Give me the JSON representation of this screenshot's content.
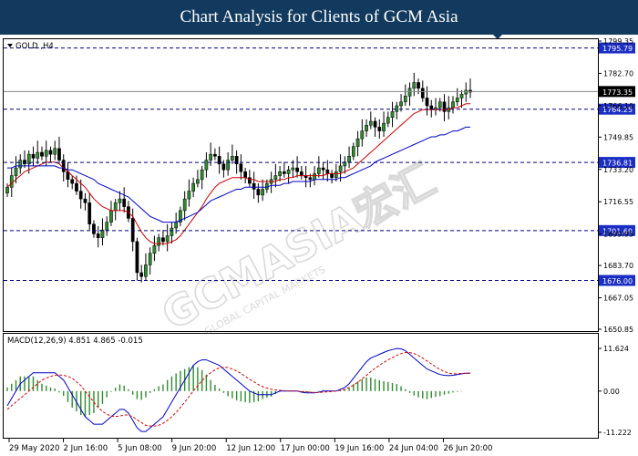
{
  "header": {
    "title": "Chart Analysis for Clients of GCM Asia"
  },
  "watermark": {
    "text": "GCMASIA宏汇",
    "subtext": "GLOBAL CAPITAL MARKETS"
  },
  "chart_data": [
    {
      "type": "candlestick",
      "symbol_label": "GOLD ,H4",
      "ylim": [
        1650.85,
        1799.35
      ],
      "y_ticks": [
        1799.35,
        1782.7,
        1766.1,
        1749.85,
        1733.2,
        1716.55,
        1699.95,
        1683.7,
        1667.05,
        1650.85
      ],
      "x_labels": [
        "29 May 2020",
        "2 Jun 16:00",
        "5 Jun 08:00",
        "9 Jun 20:00",
        "12 Jun 12:00",
        "17 Jun 00:00",
        "19 Jun 16:00",
        "24 Jun 04:00",
        "26 Jun 20:00"
      ],
      "levels": [
        1795.79,
        1764.25,
        1736.81,
        1701.69,
        1676.0
      ],
      "current_price": 1773.35,
      "series": [
        {
          "type": "candles",
          "close": [
            1724,
            1730,
            1734,
            1738,
            1736,
            1741,
            1739,
            1742,
            1740,
            1743,
            1741,
            1744,
            1738,
            1732,
            1728,
            1726,
            1722,
            1718,
            1716,
            1705,
            1700,
            1698,
            1702,
            1706,
            1712,
            1716,
            1718,
            1714,
            1708,
            1696,
            1680,
            1678,
            1684,
            1690,
            1694,
            1698,
            1696,
            1699,
            1703,
            1706,
            1712,
            1718,
            1722,
            1726,
            1728,
            1733,
            1738,
            1741,
            1740,
            1736,
            1733,
            1738,
            1740,
            1736,
            1732,
            1729,
            1726,
            1723,
            1720,
            1723,
            1726,
            1728,
            1730,
            1732,
            1731,
            1733,
            1734,
            1732,
            1730,
            1729,
            1728,
            1731,
            1734,
            1733,
            1731,
            1729,
            1732,
            1735,
            1737,
            1740,
            1745,
            1749,
            1753,
            1756,
            1758,
            1755,
            1753,
            1757,
            1760,
            1763,
            1766,
            1768,
            1771,
            1775,
            1778,
            1775,
            1770,
            1766,
            1764,
            1765,
            1768,
            1763,
            1765,
            1768,
            1770,
            1772,
            1774,
            1773
          ]
        },
        {
          "type": "ma",
          "name": "",
          "color": "#cc0000",
          "values": [
            1724,
            1726,
            1728,
            1730,
            1732,
            1733,
            1734,
            1735,
            1736,
            1737,
            1737,
            1737,
            1736,
            1734,
            1732,
            1730,
            1728,
            1726,
            1724,
            1721,
            1718,
            1716,
            1714,
            1713,
            1712,
            1712,
            1712,
            1712,
            1711,
            1709,
            1705,
            1701,
            1698,
            1696,
            1695,
            1695,
            1695,
            1695,
            1696,
            1697,
            1699,
            1702,
            1705,
            1708,
            1711,
            1714,
            1718,
            1721,
            1724,
            1726,
            1727,
            1728,
            1729,
            1729,
            1729,
            1729,
            1728,
            1728,
            1727,
            1727,
            1727,
            1727,
            1727,
            1728,
            1728,
            1729,
            1729,
            1730,
            1730,
            1730,
            1730,
            1730,
            1730,
            1730,
            1731,
            1731,
            1731,
            1731,
            1732,
            1733,
            1734,
            1736,
            1738,
            1740,
            1742,
            1744,
            1746,
            1748,
            1750,
            1752,
            1754,
            1756,
            1758,
            1760,
            1762,
            1763,
            1764,
            1764,
            1764,
            1764,
            1764,
            1764,
            1764,
            1765,
            1765,
            1766,
            1767,
            1767
          ]
        },
        {
          "type": "ma",
          "name": "",
          "color": "#0000cc",
          "values": [
            1734,
            1734,
            1735,
            1735,
            1735,
            1735,
            1735,
            1735,
            1735,
            1735,
            1735,
            1735,
            1734,
            1734,
            1733,
            1733,
            1732,
            1731,
            1730,
            1729,
            1728,
            1726,
            1725,
            1724,
            1723,
            1722,
            1721,
            1720,
            1719,
            1717,
            1715,
            1713,
            1711,
            1709,
            1708,
            1707,
            1706,
            1706,
            1706,
            1706,
            1707,
            1708,
            1709,
            1710,
            1711,
            1713,
            1715,
            1717,
            1718,
            1719,
            1720,
            1721,
            1722,
            1723,
            1723,
            1724,
            1724,
            1724,
            1724,
            1724,
            1724,
            1725,
            1725,
            1725,
            1726,
            1726,
            1727,
            1727,
            1727,
            1727,
            1727,
            1728,
            1728,
            1728,
            1728,
            1728,
            1728,
            1729,
            1729,
            1730,
            1731,
            1732,
            1733,
            1734,
            1735,
            1737,
            1738,
            1739,
            1740,
            1741,
            1742,
            1743,
            1744,
            1745,
            1746,
            1747,
            1748,
            1749,
            1750,
            1750,
            1751,
            1751,
            1752,
            1753,
            1753,
            1754,
            1755,
            1755
          ]
        }
      ]
    },
    {
      "type": "macd",
      "label": "MACD(12,26,9) 4.851 4.865 -0.015",
      "ylim": [
        -11.222,
        11.624
      ],
      "y_ticks": [
        11.624,
        0.0,
        -11.222
      ],
      "series": [
        {
          "name": "",
          "type": "line",
          "color": "#0000cc",
          "values": [
            -4,
            -2,
            0,
            2,
            3,
            4,
            5,
            5,
            5,
            5,
            5,
            5,
            4,
            3,
            1,
            -1,
            -3,
            -5,
            -7,
            -8,
            -9,
            -9,
            -9,
            -8,
            -7,
            -6,
            -5,
            -5,
            -6,
            -8,
            -10,
            -11,
            -11,
            -10,
            -9,
            -8,
            -7,
            -5,
            -3,
            -1,
            1,
            3,
            5,
            7,
            8,
            8.5,
            8.5,
            8,
            7.5,
            7,
            6,
            5,
            4,
            3,
            2,
            1,
            0,
            -0.5,
            -1,
            -1,
            -1,
            -1,
            -0.5,
            0,
            0,
            0,
            0,
            0,
            -0.3,
            -0.5,
            -0.5,
            -0.5,
            -0.3,
            0,
            0,
            0,
            0,
            0.5,
            1,
            2,
            3.5,
            5,
            6.5,
            8,
            9,
            9.5,
            10,
            10.5,
            11,
            11.3,
            11.6,
            11.5,
            11,
            10,
            9,
            8,
            7,
            6,
            5.5,
            5,
            4.5,
            4.3,
            4.2,
            4.3,
            4.5,
            4.7,
            4.85,
            4.85
          ]
        },
        {
          "name": "",
          "type": "line",
          "color": "#dd0000",
          "values": [
            -5,
            -4,
            -3,
            -2,
            -1,
            0,
            1,
            2,
            3,
            3.5,
            4,
            4.3,
            4.4,
            4.3,
            4,
            3.5,
            2.5,
            1.5,
            0,
            -1.5,
            -3,
            -4.5,
            -5.5,
            -6.3,
            -6.8,
            -6.9,
            -6.8,
            -6.5,
            -6.5,
            -7,
            -7.8,
            -8.6,
            -9.3,
            -9.5,
            -9.5,
            -9.3,
            -8.8,
            -8,
            -7,
            -5.8,
            -4.5,
            -3,
            -1.5,
            0,
            1.5,
            2.8,
            4,
            5,
            5.8,
            6.3,
            6.5,
            6.4,
            6,
            5.5,
            4.8,
            4,
            3.2,
            2.5,
            1.8,
            1.2,
            0.8,
            0.5,
            0.3,
            0.2,
            0.1,
            0.05,
            0,
            0,
            -0.1,
            -0.2,
            -0.3,
            -0.4,
            -0.4,
            -0.3,
            -0.2,
            -0.1,
            0,
            0.2,
            0.5,
            1,
            1.6,
            2.4,
            3.3,
            4.3,
            5.3,
            6.2,
            7,
            7.8,
            8.5,
            9.1,
            9.7,
            10.2,
            10.5,
            10.5,
            10.2,
            9.7,
            9,
            8.2,
            7.4,
            6.6,
            5.9,
            5.3,
            4.9,
            4.7,
            4.7,
            4.8,
            4.86,
            4.87
          ]
        }
      ]
    }
  ]
}
